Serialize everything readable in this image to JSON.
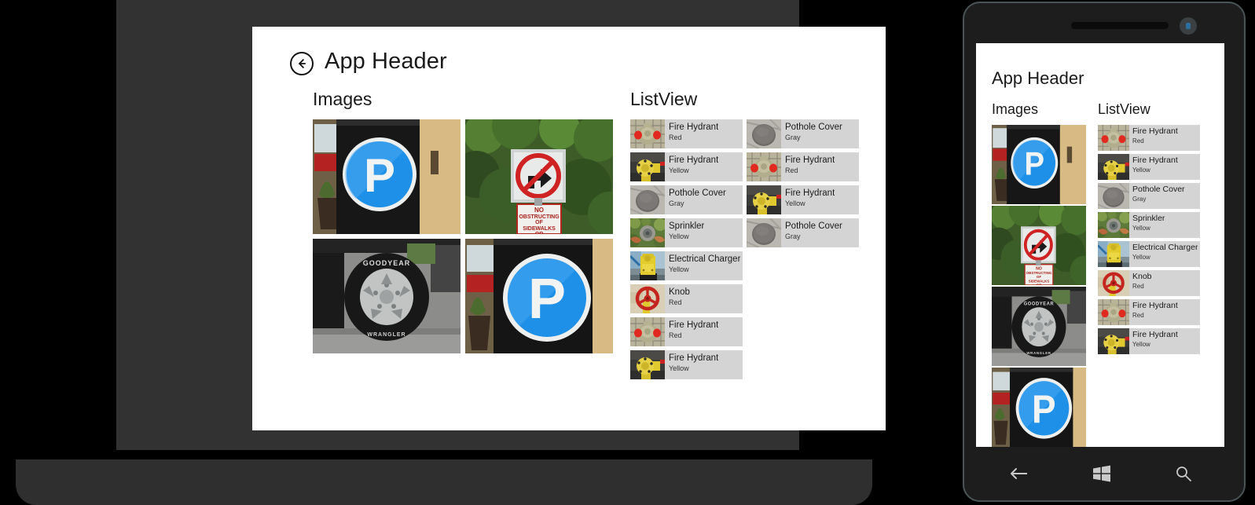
{
  "app": {
    "title": "App Header",
    "back_icon": "back-arrow-circle-icon",
    "sections": {
      "images": "Images",
      "listview": "ListView"
    }
  },
  "images": [
    {
      "name": "parking-sign-photo",
      "alt": "Blue round P parking sign on black pillar"
    },
    {
      "name": "no-right-turn-sign-photo",
      "alt": "No right turn sign with No Obstructing Of Sidewalks Or placard"
    },
    {
      "name": "tire-wheel-photo",
      "alt": "Goodyear tire and alloy wheel at curb"
    },
    {
      "name": "parking-sign-photo-2",
      "alt": "Blue round P parking sign on black pillar"
    }
  ],
  "listview": {
    "column_left": [
      {
        "title": "Fire Hydrant",
        "subtitle": "Red",
        "thumb": "fire-hydrant-red-thumb"
      },
      {
        "title": "Fire Hydrant",
        "subtitle": "Yellow",
        "thumb": "fire-hydrant-yellow-thumb"
      },
      {
        "title": "Pothole Cover",
        "subtitle": "Gray",
        "thumb": "pothole-cover-gray-thumb"
      },
      {
        "title": "Sprinkler",
        "subtitle": "Yellow",
        "thumb": "sprinkler-yellow-thumb"
      },
      {
        "title": "Electrical Charger",
        "subtitle": "Yellow",
        "thumb": "electrical-charger-yellow-thumb"
      },
      {
        "title": "Knob",
        "subtitle": "Red",
        "thumb": "knob-red-thumb"
      },
      {
        "title": "Fire Hydrant",
        "subtitle": "Red",
        "thumb": "fire-hydrant-red-thumb"
      },
      {
        "title": "Fire Hydrant",
        "subtitle": "Yellow",
        "thumb": "fire-hydrant-yellow-thumb"
      }
    ],
    "column_right": [
      {
        "title": "Pothole Cover",
        "subtitle": "Gray",
        "thumb": "pothole-cover-gray-thumb"
      },
      {
        "title": "Fire Hydrant",
        "subtitle": "Red",
        "thumb": "fire-hydrant-red-thumb"
      },
      {
        "title": "Fire Hydrant",
        "subtitle": "Yellow",
        "thumb": "fire-hydrant-yellow-thumb"
      },
      {
        "title": "Pothole Cover",
        "subtitle": "Gray",
        "thumb": "pothole-cover-gray-thumb"
      }
    ]
  },
  "phone": {
    "title": "App Header",
    "sections": {
      "images": "Images",
      "listview": "ListView"
    },
    "images": [
      {
        "name": "parking-sign-photo",
        "alt": "Blue round P parking sign"
      },
      {
        "name": "no-right-turn-sign-photo",
        "alt": "No right turn sign"
      },
      {
        "name": "tire-wheel-photo",
        "alt": "Tire and alloy wheel"
      },
      {
        "name": "parking-sign-photo-2",
        "alt": "Blue round P parking sign"
      }
    ],
    "listview": [
      {
        "title": "Fire Hydrant",
        "subtitle": "Red",
        "thumb": "fire-hydrant-red-thumb"
      },
      {
        "title": "Fire Hydrant",
        "subtitle": "Yellow",
        "thumb": "fire-hydrant-yellow-thumb"
      },
      {
        "title": "Pothole Cover",
        "subtitle": "Gray",
        "thumb": "pothole-cover-gray-thumb"
      },
      {
        "title": "Sprinkler",
        "subtitle": "Yellow",
        "thumb": "sprinkler-yellow-thumb"
      },
      {
        "title": "Electrical Charger",
        "subtitle": "Yellow",
        "thumb": "electrical-charger-yellow-thumb"
      },
      {
        "title": "Knob",
        "subtitle": "Red",
        "thumb": "knob-red-thumb"
      },
      {
        "title": "Fire Hydrant",
        "subtitle": "Red",
        "thumb": "fire-hydrant-red-thumb"
      },
      {
        "title": "Fire Hydrant",
        "subtitle": "Yellow",
        "thumb": "fire-hydrant-yellow-thumb"
      }
    ],
    "nav": [
      {
        "name": "back-button",
        "icon": "back-arrow-icon"
      },
      {
        "name": "start-button",
        "icon": "windows-logo-icon"
      },
      {
        "name": "search-button",
        "icon": "search-icon"
      }
    ]
  },
  "signs": {
    "no_obstructing": [
      "NO",
      "OBSTRUCTING",
      "OF",
      "SIDEWALKS",
      "OR"
    ],
    "parking_letter": "P",
    "tire_brand": "GOODYEAR"
  },
  "colors": {
    "list_item_bg": "#d4d4d4",
    "screen_bg": "#ffffff",
    "device_frame": "#323232",
    "phone_frame": "#1d1d1d",
    "sign_blue": "#1e90e8",
    "sign_red": "#cf2222",
    "hydrant_yellow": "#e3cf4e",
    "text_primary": "#1a1a1a"
  }
}
